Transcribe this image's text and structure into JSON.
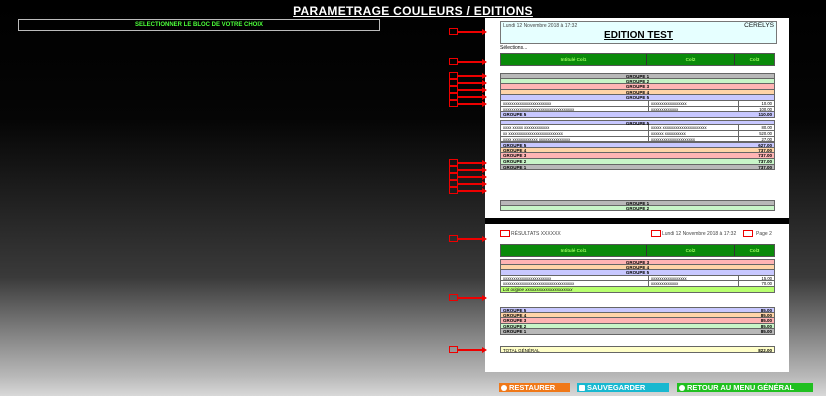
{
  "title": "PARAMETRAGE COULEURS / EDITIONS",
  "select_prompt": "SELECTIONNER LE BLOC DE VOTRE CHOIX",
  "doc1": {
    "date": "Lundi 12 Novembre 2018 à 17:32",
    "brand": "CERELYS",
    "edition": "EDITION TEST",
    "selections": "Sélections...",
    "headers": [
      "Intitulé Col1",
      "Col2",
      "Col3"
    ],
    "top_groups": [
      "GROUPE 1",
      "GROUPE 2",
      "GROUPE 3",
      "GROUPE 4",
      "GROUPE 5"
    ],
    "rows1": [
      [
        "xxxxxxxxxxxxxxxxxxxxxxx",
        "xxxxxxxxxxxxxxxxx",
        "10.00"
      ],
      [
        "xxxxxxxxxxxxxxxxxxxxxxxxxxxxxxxxxx",
        "xxxxxxxxxxxxx",
        "100.00"
      ]
    ],
    "g5_total": {
      "label": "GROUPE 5",
      "value": "110.00"
    },
    "g5_header": "GROUPE 5",
    "rows2": [
      [
        "xxxx xxxxx xxxxxxxxxxxx",
        "xxxxx xxxxxxxxxxxxxxxxxxxxx",
        "80.00"
      ],
      [
        "xx xxxxxxxxxxxxxxxxxxxxxxxxxx",
        "xxxxxx xxxxxxxxxx",
        "520.00"
      ],
      [
        "xxxx xxxxxxxxxxxx xxxxxxxxxxxxxxx",
        "xxxxxxxxxxxxxxxxxxxxx",
        "27.00"
      ]
    ],
    "totals": [
      [
        "GROUPE 5",
        "627.00"
      ],
      [
        "GROUPE 4",
        "737.00"
      ],
      [
        "GROUPE 3",
        "737.00"
      ],
      [
        "GROUPE 2",
        "737.00"
      ],
      [
        "GROUPE 1",
        "737.00"
      ]
    ],
    "bottom_groups": [
      "GROUPE 1",
      "GROUPE 2"
    ]
  },
  "doc2": {
    "results": "RÉSULTATS XXXXXX",
    "date": "Lundi 12 Novembre 2018 à 17:32",
    "page": "Page 2",
    "headers": [
      "Intitulé Col1",
      "Col2",
      "Col3"
    ],
    "groups": [
      "GROUPE 3",
      "GROUPE 4",
      "GROUPE 5"
    ],
    "rows": [
      [
        "xxxxxxxxxxxxxxxxxxxxxxx",
        "xxxxxxxxxxxxxxxxx",
        "15.00"
      ],
      [
        "xxxxxxxxxxxxxxxxxxxxxxxxxxxxxxxxxx",
        "xxxxxxxxxxxxx",
        "70.00"
      ]
    ],
    "lot_origine": "Lot origine xxxxxxxxxxxxxxxxxxxxx",
    "totals": [
      [
        "GROUPE 5",
        "85.00"
      ],
      [
        "GROUPE 4",
        "85.00"
      ],
      [
        "GROUPE 3",
        "85.00"
      ],
      [
        "GROUPE 2",
        "85.00"
      ],
      [
        "GROUPE 1",
        "85.00"
      ]
    ],
    "grand_total": {
      "label": "TOTAL GÉNÉRAL",
      "value": "822.00"
    }
  },
  "buttons": {
    "restore": "RESTAURER",
    "save": "SAUVEGARDER",
    "back": "RETOUR AU MENU GÉNÉRAL"
  },
  "colors": {
    "g1": "#b8b8b8",
    "g2": "#c8f5c8",
    "g3": "#ffb4b4",
    "g4": "#ffd4a8",
    "g5": "#c8c8ff",
    "header": "#0a8a0a",
    "restore": "#f07818",
    "save": "#18b8d0",
    "back": "#20c020"
  }
}
